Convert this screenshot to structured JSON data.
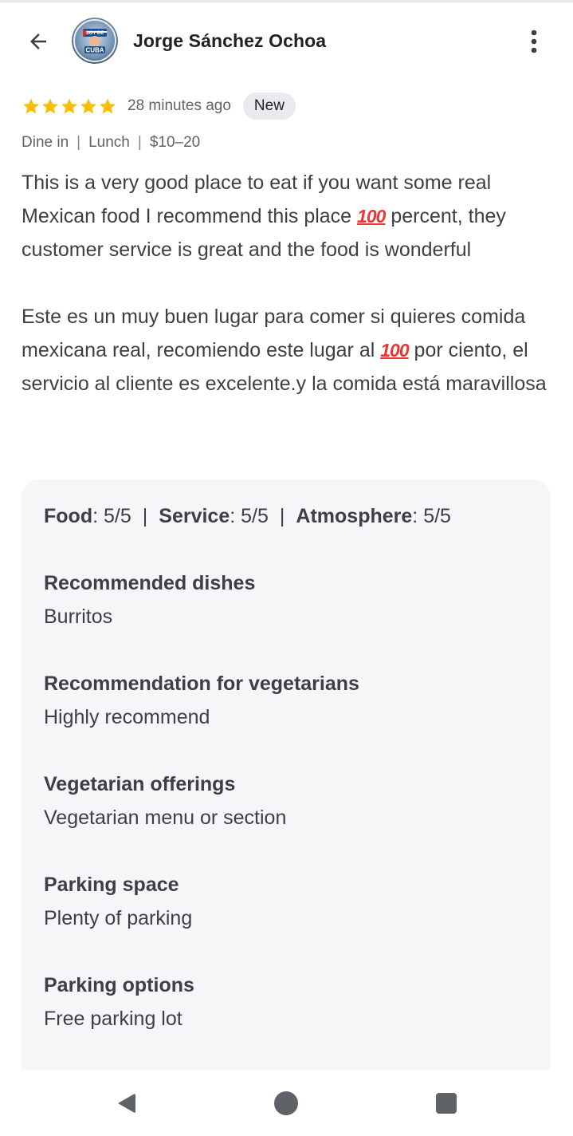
{
  "header": {
    "author": "Jorge Sánchez Ochoa",
    "avatar_text_top": "SOY DE",
    "avatar_text_bottom": "CUBA"
  },
  "review_meta": {
    "rating": 5,
    "time": "28 minutes ago",
    "badge": "New",
    "tags": [
      "Dine in",
      "Lunch",
      "$10–20"
    ]
  },
  "review": {
    "en_before": "This is a very good place to eat if you want some real Mexican food I recommend this place ",
    "en_after": " percent, they customer service is great and the food is wonderful",
    "es_before": "Este es un muy buen lugar para comer si quieres comida mexicana real, recomiendo este lugar al ",
    "es_after": " por ciento, el servicio al cliente es excelente.y la comida está maravillosa",
    "emoji": "100"
  },
  "scores": [
    {
      "label": "Food",
      "value": "5/5"
    },
    {
      "label": "Service",
      "value": "5/5"
    },
    {
      "label": "Atmosphere",
      "value": "5/5"
    }
  ],
  "attributes": [
    {
      "label": "Recommended dishes",
      "value": "Burritos"
    },
    {
      "label": "Recommendation for vegetarians",
      "value": "Highly recommend"
    },
    {
      "label": "Vegetarian offerings",
      "value": "Vegetarian menu or section"
    },
    {
      "label": "Parking space",
      "value": "Plenty of parking"
    },
    {
      "label": "Parking options",
      "value": "Free parking lot"
    }
  ],
  "colors": {
    "star": "#fbbc04",
    "text": "#3c4043",
    "muted": "#5f6368",
    "card_bg": "#f5f6f8",
    "badge_bg": "#e8eaed",
    "emoji_red": "#e53935",
    "nav_icon": "#5f6368"
  },
  "icons": {
    "back": "arrow-left-icon",
    "more": "more-vertical-icon",
    "star": "star-icon",
    "nav_back": "triangle-back-icon",
    "nav_home": "circle-home-icon",
    "nav_recents": "square-recents-icon"
  }
}
